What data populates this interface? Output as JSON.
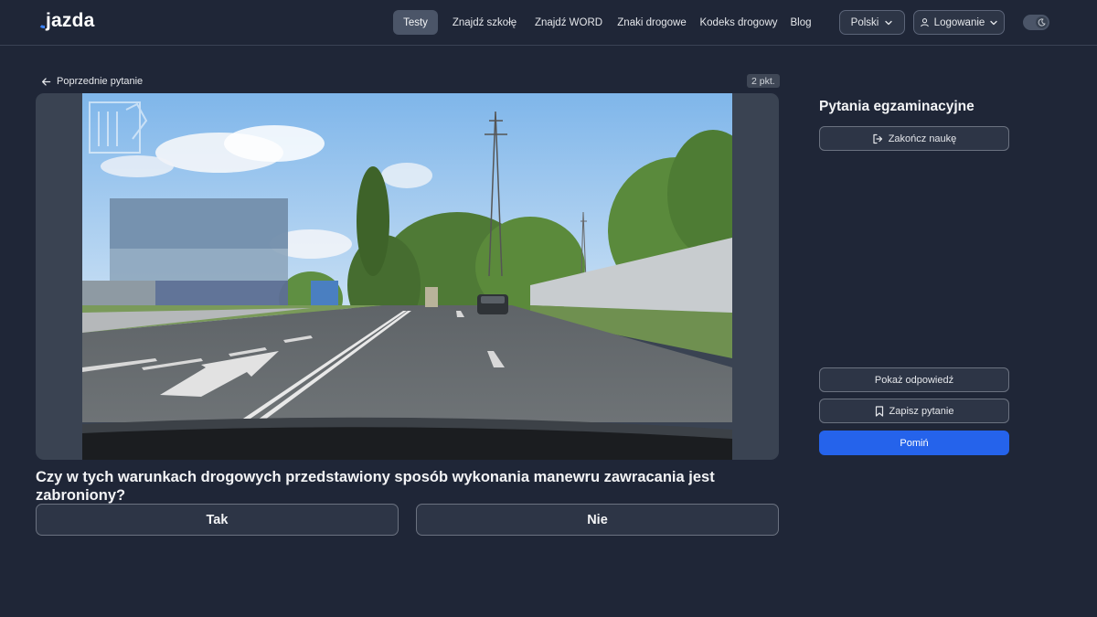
{
  "header": {
    "logo": "jazda",
    "nav": [
      {
        "label": "Testy",
        "active": true
      },
      {
        "label": "Znajdź szkołę",
        "active": false
      },
      {
        "label": "Znajdź WORD",
        "active": false
      },
      {
        "label": "Znaki drogowe",
        "active": false
      },
      {
        "label": "Kodeks drogowy",
        "active": false
      },
      {
        "label": "Blog",
        "active": false
      }
    ],
    "language": "Polski",
    "login": "Logowanie"
  },
  "main": {
    "back_label": "Poprzednie pytanie",
    "points": "2 pkt.",
    "question": "Czy w tych warunkach drogowych przedstawiony sposób wykonania manewru zawracania jest zabroniony?",
    "answers": [
      "Tak",
      "Nie"
    ]
  },
  "sidebar": {
    "title": "Pytania egzaminacyjne",
    "finish_label": "Zakończ naukę",
    "show_answer_label": "Pokaż odpowiedź",
    "save_question_label": "Zapisz pytanie",
    "skip_label": "Pomiń"
  },
  "colors": {
    "background": "#1f2637",
    "accent": "#2563eb",
    "brand": "#3b82f6"
  },
  "icons": [
    "arrow-left-icon",
    "chevron-down-icon",
    "user-icon",
    "moon-icon",
    "logout-icon",
    "bookmark-icon"
  ]
}
